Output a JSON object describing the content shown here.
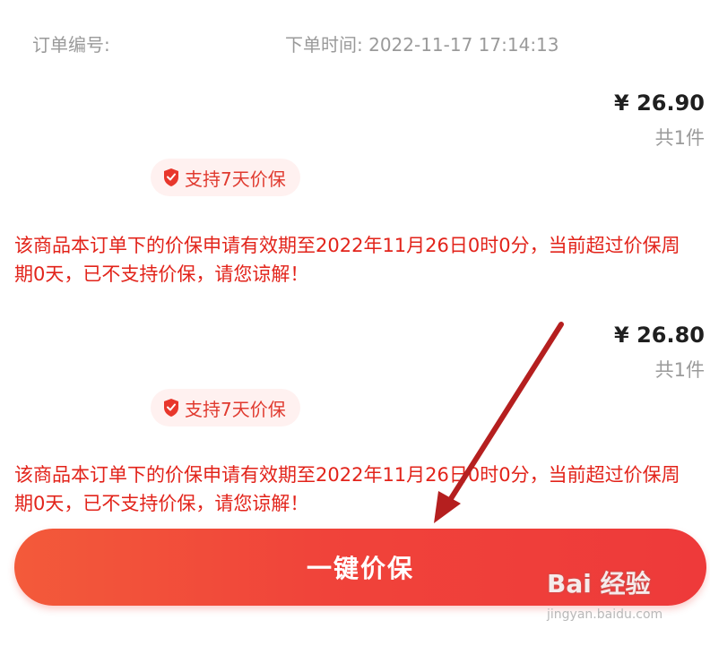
{
  "header": {
    "order_number_label": "订单编号:",
    "order_time_text": "下单时间: 2022-11-17 17:14:13"
  },
  "items": [
    {
      "price": "¥ 26.90",
      "quantity": "共1件",
      "badge": "支持7天价保",
      "notice": "该商品本订单下的价保申请有效期至2022年11月26日0时0分，当前超过价保周期0天，已不支持价保，请您谅解！"
    },
    {
      "price": "¥ 26.80",
      "quantity": "共1件",
      "badge": "支持7天价保",
      "notice": "该商品本订单下的价保申请有效期至2022年11月26日0时0分，当前超过价保周期0天，已不支持价保，请您谅解！"
    }
  ],
  "action": {
    "label": "一键价保"
  },
  "watermark": {
    "brand": "Bai 经验",
    "url": "jingyan.baidu.com"
  },
  "colors": {
    "accent_red": "#e2231a",
    "button_red": "#f0433a",
    "annotation_arrow": "#b51f1f"
  },
  "icons": {
    "badge_icon": "shield-check-icon",
    "annotation": "arrow-pointer-icon"
  }
}
